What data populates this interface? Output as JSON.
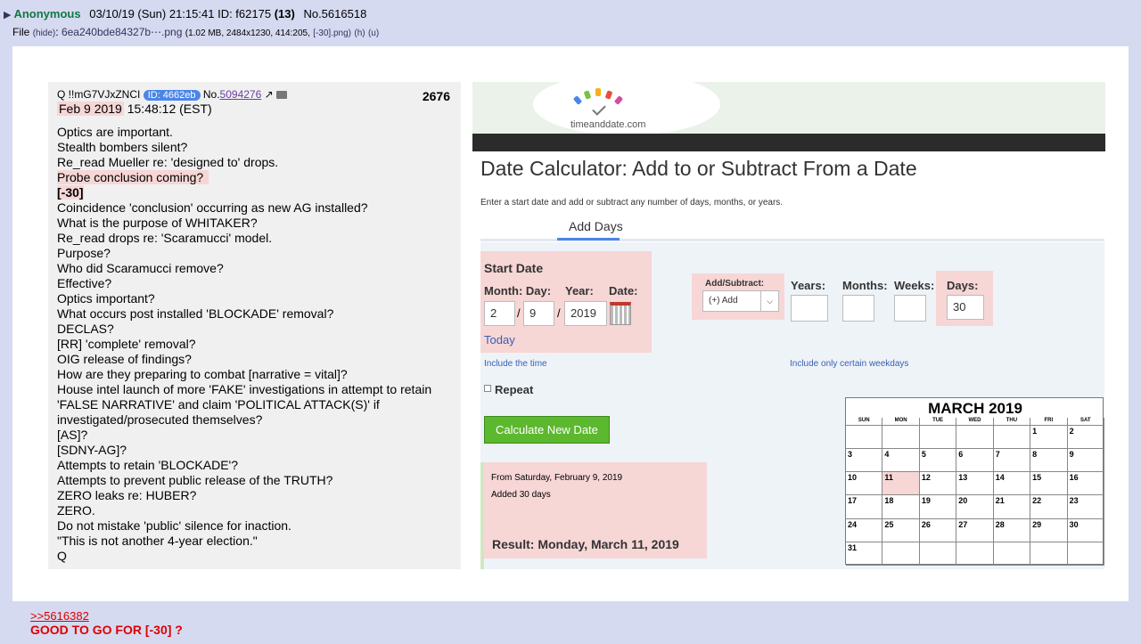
{
  "post": {
    "name": "Anonymous",
    "datetime": "03/10/19 (Sun) 21:15:41",
    "id_label": "ID: f62175",
    "id_count": "(13)",
    "number": "No.5616518",
    "file_prefix": "File",
    "hide_label": "(hide)",
    "file_name": "6ea240bde84327b⋯.png",
    "file_meta": "(1.02 MB, 2484x1230, 414:205,",
    "file_alt_name": "[-30].png)",
    "file_h": "(h)",
    "file_u": "(u)"
  },
  "q": {
    "tripcode": "Q !!mG7VJxZNCI",
    "id_badge": "ID: 4662eb",
    "no_prefix": "No.",
    "no_value": "5094276",
    "count": "2676",
    "date": "Feb 9 2019",
    "time": "15:48:12 (EST)",
    "lines": [
      "Optics are important.",
      "Stealth bombers silent?",
      "Re_read Mueller re: 'designed to' drops.",
      "Probe conclusion coming?",
      "[-30]",
      "Coincidence 'conclusion' occurring as new AG installed?",
      "What is the purpose of WHITAKER?",
      "Re_read drops re: 'Scaramucci' model.",
      "Purpose?",
      "Who did Scaramucci remove?",
      "Effective?",
      "Optics important?",
      "What occurs post installed 'BLOCKADE' removal?",
      "DECLAS?",
      "[RR] 'complete' removal?",
      "OIG release of findings?",
      "How are they preparing to combat [narrative = vital]?",
      "House intel launch of more 'FAKE' investigations in attempt to retain 'FALSE NARRATIVE' and claim 'POLITICAL ATTACK(S)' if investigated/prosecuted themselves?",
      "[AS]?",
      "[SDNY-AG]?",
      "Attempts to retain 'BLOCKADE'?",
      "Attempts to prevent public release of the TRUTH?",
      "ZERO leaks re: HUBER?",
      "ZERO.",
      "Do not mistake 'public' silence for inaction.",
      "\"This is not another 4-year election.\"",
      "Q"
    ]
  },
  "calc": {
    "logo": "timeanddate.com",
    "title": "Date Calculator: Add to or Subtract From a Date",
    "subtitle": "Enter a start date and add or subtract any number of days, months, or years.",
    "tab": "Add Days",
    "start_date": "Start Date",
    "month_day_label": "Month: Day:",
    "year_label": "Year:",
    "date_label": "Date:",
    "month": "2",
    "day": "9",
    "year": "2019",
    "today": "Today",
    "add_subtract_label": "Add/Subtract:",
    "add_subtract_value": "(+) Add",
    "years_label": "Years:",
    "months_label": "Months:",
    "weeks_label": "Weeks:",
    "days_label": "Days:",
    "days_value": "30",
    "include_time": "Include the time",
    "include_weekdays": "Include only certain weekdays",
    "repeat": "Repeat",
    "button": "Calculate New Date",
    "from_text": "From Saturday, February 9, 2019",
    "added_text": "Added 30 days",
    "result": "Result: Monday, March 11, 2019"
  },
  "calendar": {
    "title": "MARCH  2019",
    "days": [
      "SUN",
      "MON",
      "TUE",
      "WED",
      "THU",
      "FRI",
      "SAT"
    ],
    "highlight": 11
  },
  "reply": {
    "link": ">>5616382",
    "text": "GOOD TO GO FOR [-30] ?"
  }
}
